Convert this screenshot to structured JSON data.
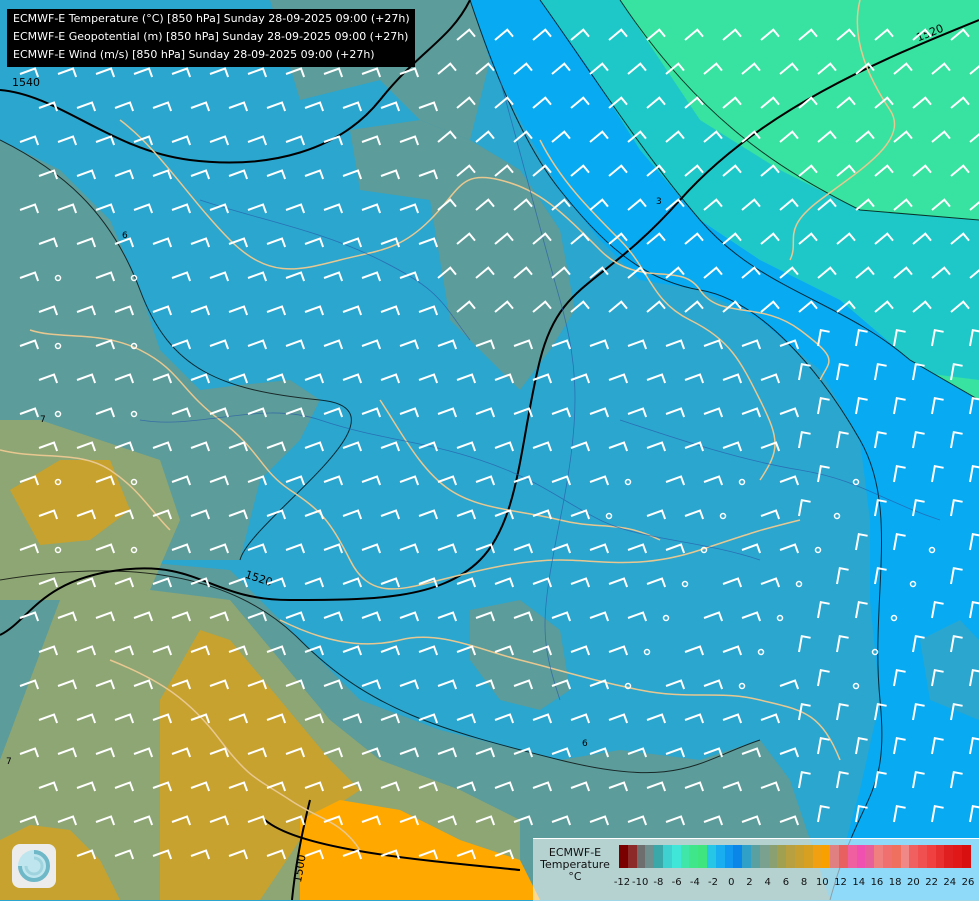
{
  "header": {
    "lines": [
      "ECMWF-E Temperature (°C) [850 hPa] Sunday 28-09-2025 09:00 (+27h)",
      "ECMWF-E Geopotential (m) [850 hPa] Sunday 28-09-2025 09:00 (+27h)",
      "ECMWF-E Wind (m/s) [850 hPa] Sunday 28-09-2025 09:00 (+27h)"
    ]
  },
  "legend": {
    "title_line1": "ECMWF-E",
    "title_line2": "Temperature",
    "title_line3": "°C",
    "ticks": [
      "-12",
      "-10",
      "-8",
      "-6",
      "-4",
      "-2",
      "0",
      "2",
      "4",
      "6",
      "8",
      "10",
      "12",
      "14",
      "16",
      "18",
      "20",
      "22",
      "24",
      "26"
    ],
    "colors": [
      "#7a0000",
      "#8c2a2a",
      "#6e6e6e",
      "#6f8f8f",
      "#3aa8a8",
      "#3fd0d0",
      "#40e6d8",
      "#3fe6a8",
      "#3fe68a",
      "#3fe680",
      "#26c6e6",
      "#18aef0",
      "#1098f0",
      "#0a86e8",
      "#30a0c8",
      "#5aa0a0",
      "#7aa090",
      "#8aa070",
      "#a0a050",
      "#b8a040",
      "#c8a030",
      "#d8a020",
      "#f0a010",
      "#f8a000",
      "#e08080",
      "#e86060",
      "#f060a0",
      "#f050b0",
      "#e8609a",
      "#f08080",
      "#f07070",
      "#f07060",
      "#f08888",
      "#f06060",
      "#f05050",
      "#f04040",
      "#e83030",
      "#e02020",
      "#e01818",
      "#d81010"
    ]
  },
  "map": {
    "contour_labels": {
      "geo_1520_ne": "1520",
      "geo_1540": "1540",
      "geo_1520_w": "1520",
      "geo_1500": "1500",
      "t_6_w": "6",
      "t_6_s": "6",
      "t_3": "3",
      "t_7": "7",
      "t_7_sw": "7"
    },
    "colors": {
      "cold_cyan": "#2aa6cf",
      "bright_blue": "#08aaf2",
      "teal": "#1fc8c8",
      "green": "#38e2a0",
      "olive": "#5c9c9a",
      "khaki": "#8ea674",
      "gold": "#c7a22e",
      "orange": "#ffa800"
    },
    "logo": "ecmwf-swirl-icon"
  }
}
